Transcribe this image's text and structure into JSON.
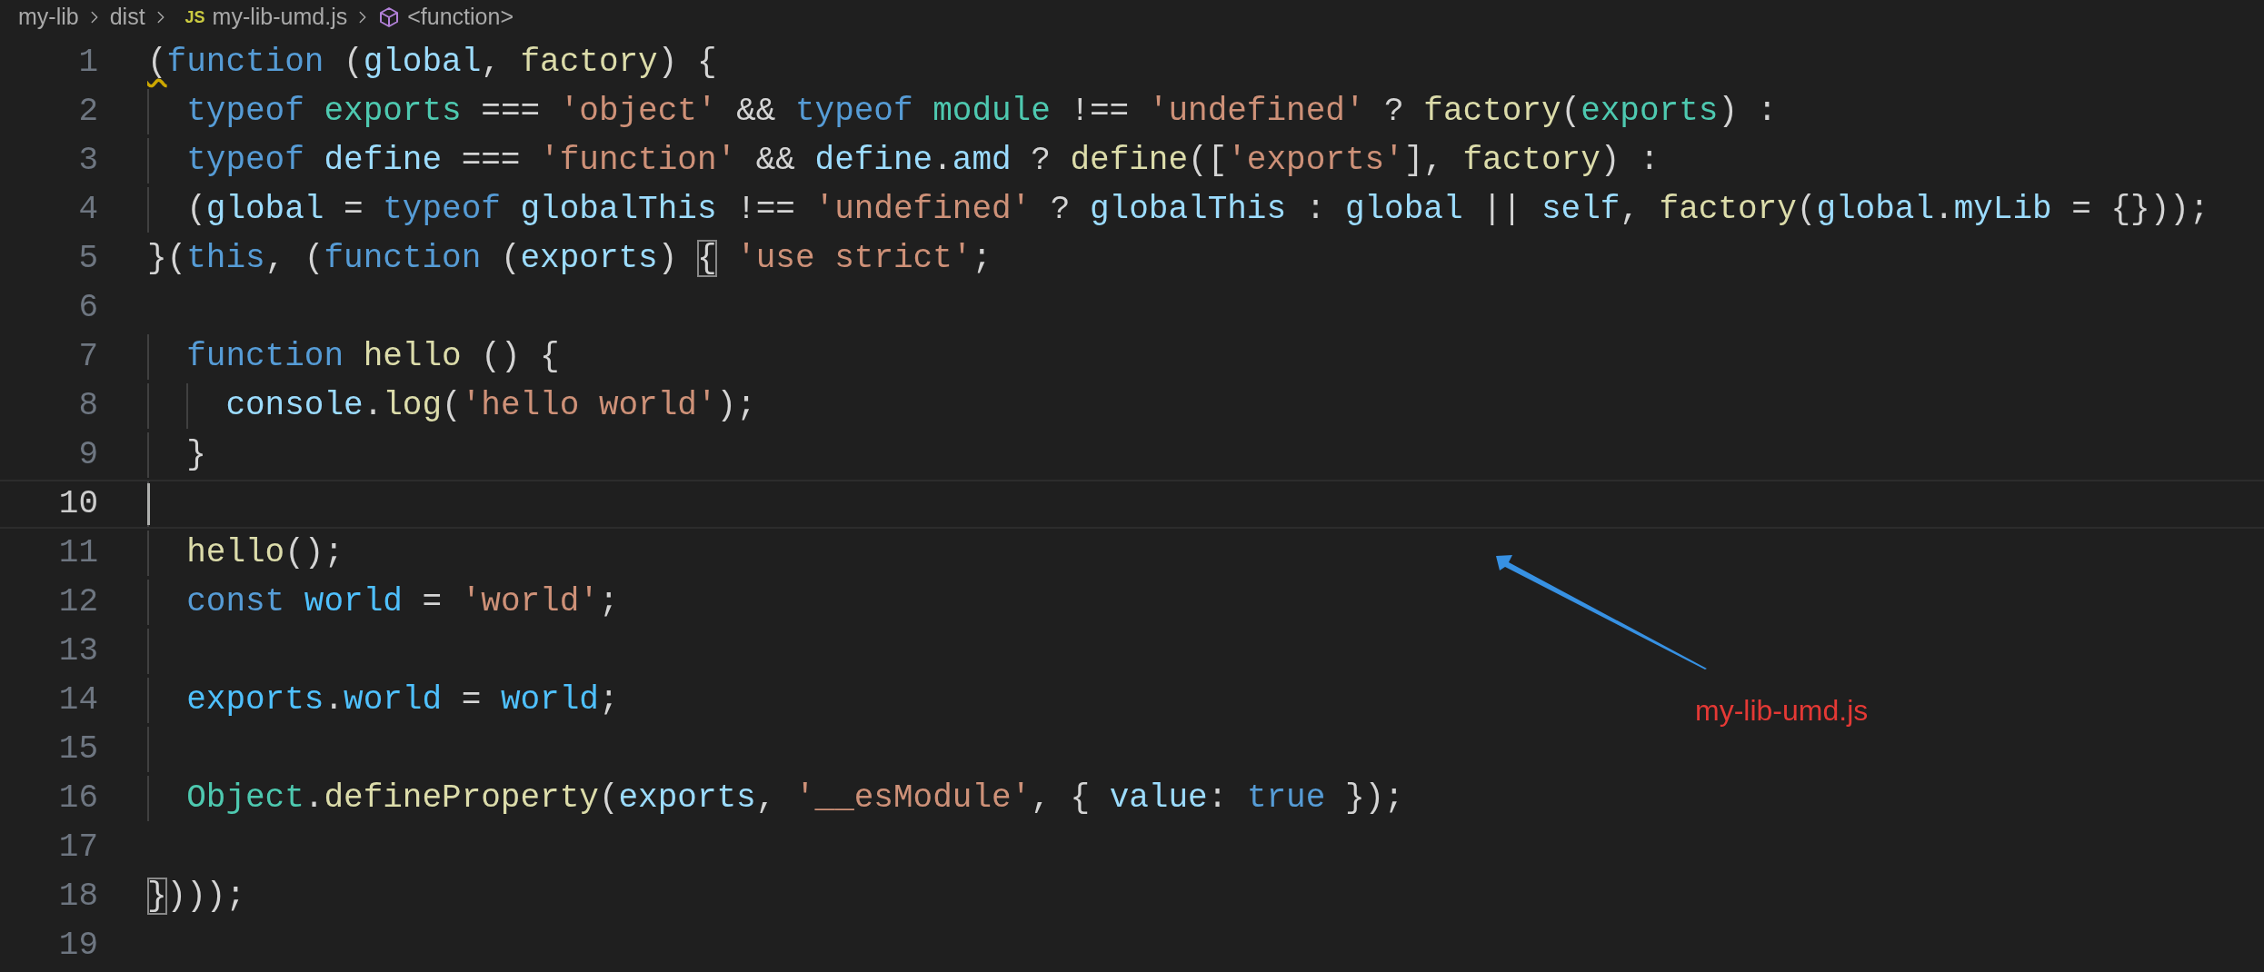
{
  "breadcrumb": [
    {
      "kind": "folder",
      "label": "my-lib"
    },
    {
      "kind": "folder",
      "label": "dist"
    },
    {
      "kind": "file",
      "badge": "JS",
      "label": "my-lib-umd.js"
    },
    {
      "kind": "symbol",
      "label": "<function>"
    }
  ],
  "lines": [
    {
      "number": "1",
      "current": false,
      "tokens": [
        {
          "kind": "warn",
          "text": "("
        },
        {
          "kind": "kw",
          "text": "function"
        },
        {
          "kind": "p",
          "text": " ("
        },
        {
          "kind": "var",
          "text": "global"
        },
        {
          "kind": "p",
          "text": ", "
        },
        {
          "kind": "fn",
          "text": "factory"
        },
        {
          "kind": "p",
          "text": ") {"
        }
      ]
    },
    {
      "number": "2",
      "current": false,
      "tokens": [
        {
          "kind": "kw",
          "text": "  typeof "
        },
        {
          "kind": "type",
          "text": "exports"
        },
        {
          "kind": "p",
          "text": " === "
        },
        {
          "kind": "str",
          "text": "'object'"
        },
        {
          "kind": "p",
          "text": " && "
        },
        {
          "kind": "kw",
          "text": "typeof "
        },
        {
          "kind": "type",
          "text": "module"
        },
        {
          "kind": "p",
          "text": " !== "
        },
        {
          "kind": "str",
          "text": "'undefined'"
        },
        {
          "kind": "p",
          "text": " ? "
        },
        {
          "kind": "fn",
          "text": "factory"
        },
        {
          "kind": "p",
          "text": "("
        },
        {
          "kind": "type",
          "text": "exports"
        },
        {
          "kind": "p",
          "text": ") :"
        }
      ]
    },
    {
      "number": "3",
      "current": false,
      "tokens": [
        {
          "kind": "kw",
          "text": "  typeof "
        },
        {
          "kind": "var",
          "text": "define"
        },
        {
          "kind": "p",
          "text": " === "
        },
        {
          "kind": "str",
          "text": "'function'"
        },
        {
          "kind": "p",
          "text": " && "
        },
        {
          "kind": "var",
          "text": "define"
        },
        {
          "kind": "p",
          "text": "."
        },
        {
          "kind": "var",
          "text": "amd"
        },
        {
          "kind": "p",
          "text": " ? "
        },
        {
          "kind": "fn",
          "text": "define"
        },
        {
          "kind": "p",
          "text": "(["
        },
        {
          "kind": "str",
          "text": "'exports'"
        },
        {
          "kind": "p",
          "text": "], "
        },
        {
          "kind": "fn",
          "text": "factory"
        },
        {
          "kind": "p",
          "text": ") :"
        }
      ]
    },
    {
      "number": "4",
      "current": false,
      "tokens": [
        {
          "kind": "p",
          "text": "  ("
        },
        {
          "kind": "var",
          "text": "global"
        },
        {
          "kind": "p",
          "text": " = "
        },
        {
          "kind": "kw",
          "text": "typeof "
        },
        {
          "kind": "var",
          "text": "globalThis"
        },
        {
          "kind": "p",
          "text": " !== "
        },
        {
          "kind": "str",
          "text": "'undefined'"
        },
        {
          "kind": "p",
          "text": " ? "
        },
        {
          "kind": "var",
          "text": "globalThis"
        },
        {
          "kind": "p",
          "text": " : "
        },
        {
          "kind": "var",
          "text": "global"
        },
        {
          "kind": "p",
          "text": " || "
        },
        {
          "kind": "var",
          "text": "self"
        },
        {
          "kind": "p",
          "text": ", "
        },
        {
          "kind": "fn",
          "text": "factory"
        },
        {
          "kind": "p",
          "text": "("
        },
        {
          "kind": "var",
          "text": "global"
        },
        {
          "kind": "p",
          "text": "."
        },
        {
          "kind": "var",
          "text": "myLib"
        },
        {
          "kind": "p",
          "text": " = {}));"
        }
      ]
    },
    {
      "number": "5",
      "current": false,
      "tokens": [
        {
          "kind": "p",
          "text": "}("
        },
        {
          "kind": "kw",
          "text": "this"
        },
        {
          "kind": "p",
          "text": ", ("
        },
        {
          "kind": "kw",
          "text": "function"
        },
        {
          "kind": "p",
          "text": " ("
        },
        {
          "kind": "var",
          "text": "exports"
        },
        {
          "kind": "p",
          "text": ") "
        },
        {
          "kind": "match",
          "text": "{"
        },
        {
          "kind": "str",
          "text": " 'use strict'"
        },
        {
          "kind": "p",
          "text": ";"
        }
      ]
    },
    {
      "number": "6",
      "current": false
    },
    {
      "number": "7",
      "current": false,
      "tokens": [
        {
          "kind": "kw",
          "text": "  function "
        },
        {
          "kind": "fn",
          "text": "hello"
        },
        {
          "kind": "p",
          "text": " () {"
        }
      ]
    },
    {
      "number": "8",
      "current": false,
      "tokens": [
        {
          "kind": "var",
          "text": "    console"
        },
        {
          "kind": "p",
          "text": "."
        },
        {
          "kind": "fn",
          "text": "log"
        },
        {
          "kind": "p",
          "text": "("
        },
        {
          "kind": "str",
          "text": "'hello world'"
        },
        {
          "kind": "p",
          "text": ");"
        }
      ]
    },
    {
      "number": "9",
      "current": false,
      "tokens": [
        {
          "kind": "p",
          "text": "  }"
        }
      ]
    },
    {
      "number": "10",
      "current": true
    },
    {
      "number": "11",
      "current": false,
      "tokens": [
        {
          "kind": "fn",
          "text": "  hello"
        },
        {
          "kind": "p",
          "text": "();"
        }
      ]
    },
    {
      "number": "12",
      "current": false,
      "tokens": [
        {
          "kind": "kw",
          "text": "  const "
        },
        {
          "kind": "const",
          "text": "world"
        },
        {
          "kind": "p",
          "text": " = "
        },
        {
          "kind": "str",
          "text": "'world'"
        },
        {
          "kind": "p",
          "text": ";"
        }
      ]
    },
    {
      "number": "13",
      "current": false
    },
    {
      "number": "14",
      "current": false,
      "tokens": [
        {
          "kind": "const",
          "text": "  exports"
        },
        {
          "kind": "p",
          "text": "."
        },
        {
          "kind": "const",
          "text": "world"
        },
        {
          "kind": "p",
          "text": " = "
        },
        {
          "kind": "const",
          "text": "world"
        },
        {
          "kind": "p",
          "text": ";"
        }
      ]
    },
    {
      "number": "15",
      "current": false
    },
    {
      "number": "16",
      "current": false,
      "tokens": [
        {
          "kind": "type",
          "text": "  Object"
        },
        {
          "kind": "p",
          "text": "."
        },
        {
          "kind": "fn",
          "text": "defineProperty"
        },
        {
          "kind": "p",
          "text": "("
        },
        {
          "kind": "var",
          "text": "exports"
        },
        {
          "kind": "p",
          "text": ", "
        },
        {
          "kind": "str",
          "text": "'__esModule'"
        },
        {
          "kind": "p",
          "text": ", { "
        },
        {
          "kind": "var",
          "text": "value"
        },
        {
          "kind": "p",
          "text": ": "
        },
        {
          "kind": "kw",
          "text": "true"
        },
        {
          "kind": "p",
          "text": " });"
        }
      ]
    },
    {
      "number": "17",
      "current": false
    },
    {
      "number": "18",
      "current": false,
      "tokens": [
        {
          "kind": "match",
          "text": "}"
        },
        {
          "kind": "p",
          "text": ")));"
        }
      ]
    },
    {
      "number": "19",
      "current": false
    }
  ],
  "annotation": {
    "label": "my-lib-umd.js"
  }
}
